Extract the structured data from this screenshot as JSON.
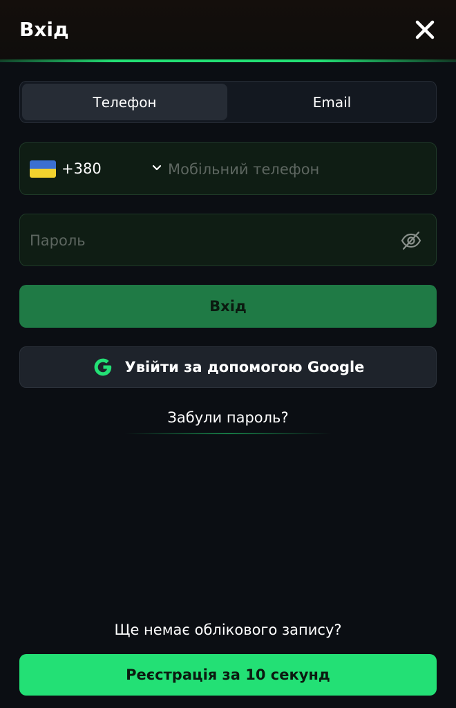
{
  "header": {
    "title": "Вхід",
    "close_icon": "close-icon"
  },
  "tabs": [
    {
      "label": "Телефон",
      "active": true
    },
    {
      "label": "Email",
      "active": false
    }
  ],
  "phone": {
    "country_flag": "ukraine-flag-icon",
    "country_code": "+380",
    "chevron_icon": "chevron-down-icon",
    "placeholder": "Мобільний телефон",
    "value": ""
  },
  "password": {
    "placeholder": "Пароль",
    "value": "",
    "toggle_icon": "eye-off-icon"
  },
  "login_button": {
    "label": "Вхід"
  },
  "google_button": {
    "icon": "google-icon",
    "label": "Увійти за допомогою Google"
  },
  "forgot_password": {
    "label": "Забули пароль?"
  },
  "register": {
    "prompt": "Ще немає облікового запису?",
    "button_label": "Реєстрація за 10 секунд"
  },
  "colors": {
    "accent": "#23e075",
    "login_button_bg": "#1f7a45",
    "background": "#0b0e13",
    "input_bg": "#0f1d14",
    "flag_blue": "#3b6fd1",
    "flag_yellow": "#f2d22e"
  }
}
